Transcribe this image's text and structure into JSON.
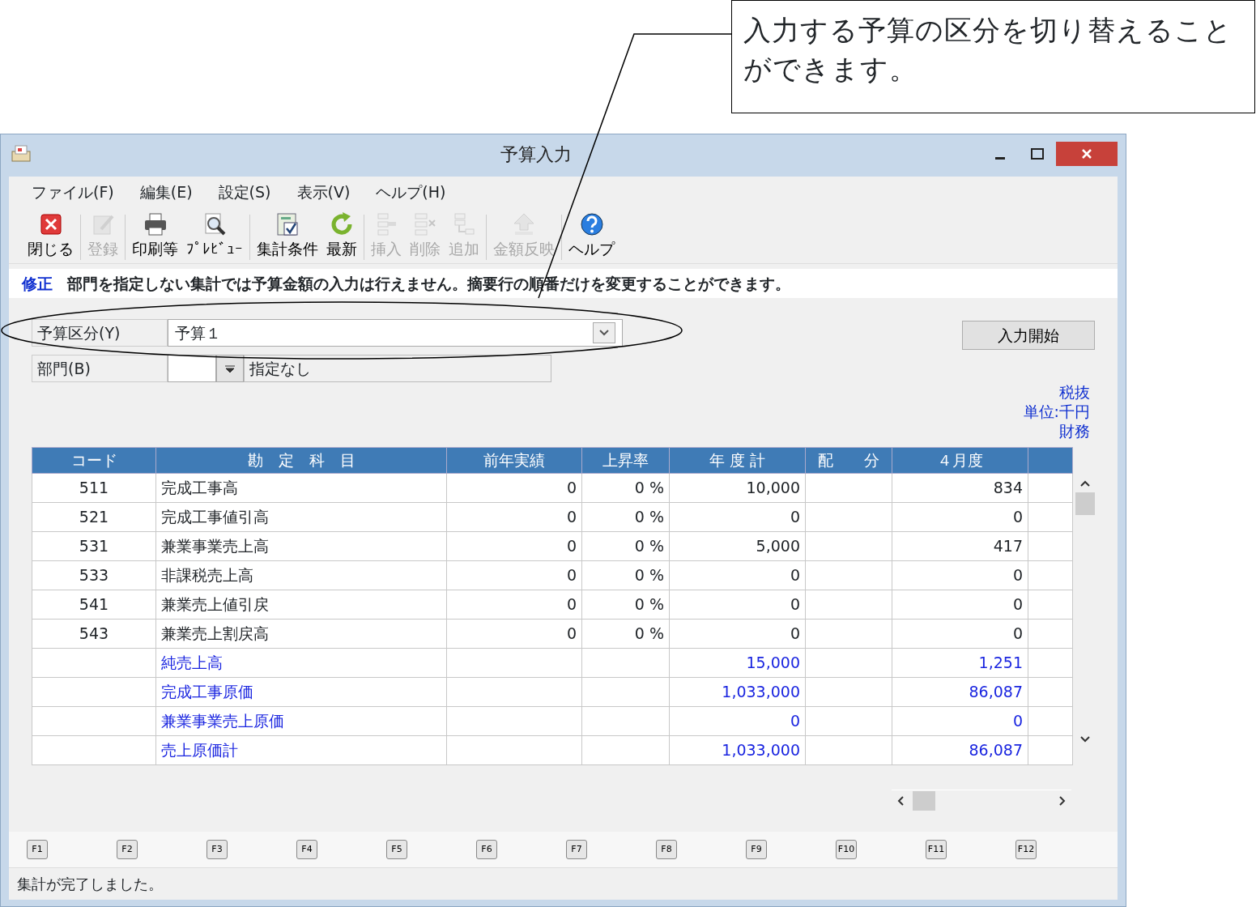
{
  "callout": {
    "text": "入力する予算の区分を切り替えることができます。"
  },
  "window": {
    "title": "予算入力"
  },
  "menu": [
    "ファイル(F)",
    "編集(E)",
    "設定(S)",
    "表示(V)",
    "ヘルプ(H)"
  ],
  "toolbar": [
    {
      "kind": "close",
      "label": "閉じる",
      "disabled": false
    },
    {
      "kind": "register",
      "label": "登録",
      "disabled": true
    },
    {
      "kind": "print",
      "label": "印刷等",
      "disabled": false
    },
    {
      "kind": "preview",
      "label": "ﾌﾟﾚﾋﾞｭｰ",
      "disabled": false
    },
    {
      "kind": "conditions",
      "label": "集計条件",
      "disabled": false
    },
    {
      "kind": "refresh",
      "label": "最新",
      "disabled": false
    },
    {
      "kind": "insert",
      "label": "挿入",
      "disabled": true
    },
    {
      "kind": "delete",
      "label": "削除",
      "disabled": true
    },
    {
      "kind": "append",
      "label": "追加",
      "disabled": true
    },
    {
      "kind": "reflect",
      "label": "金額反映",
      "disabled": true
    },
    {
      "kind": "help",
      "label": "ヘルプ",
      "disabled": false
    }
  ],
  "mode": {
    "label": "修正",
    "message": "部門を指定しない集計では予算金額の入力は行えません。摘要行の順番だけを変更することができます。"
  },
  "budget_type": {
    "label": "予算区分(Y)",
    "value": "予算１"
  },
  "department": {
    "label": "部門(B)",
    "name": "指定なし"
  },
  "start_button": "入力開始",
  "info": [
    "税抜",
    "単位:千円",
    "財務"
  ],
  "table": {
    "columns": [
      "コード",
      "勘　定　科　目",
      "前年実績",
      "上昇率",
      "年 度 計",
      "配　　分",
      "４月度"
    ],
    "rows": [
      {
        "kind": "account",
        "cells": [
          "511",
          "完成工事高",
          "0",
          "0 %",
          "10,000",
          "",
          "834"
        ]
      },
      {
        "kind": "account",
        "cells": [
          "521",
          "完成工事値引高",
          "0",
          "0 %",
          "0",
          "",
          "0"
        ]
      },
      {
        "kind": "account",
        "cells": [
          "531",
          "兼業事業売上高",
          "0",
          "0 %",
          "5,000",
          "",
          "417"
        ]
      },
      {
        "kind": "account",
        "cells": [
          "533",
          "非課税売上高",
          "0",
          "0 %",
          "0",
          "",
          "0"
        ]
      },
      {
        "kind": "account",
        "cells": [
          "541",
          "兼業売上値引戻",
          "0",
          "0 %",
          "0",
          "",
          "0"
        ]
      },
      {
        "kind": "account",
        "cells": [
          "543",
          "兼業売上割戻高",
          "0",
          "0 %",
          "0",
          "",
          "0"
        ]
      },
      {
        "kind": "total",
        "cells": [
          "",
          "純売上高",
          "",
          "",
          "15,000",
          "",
          "1,251"
        ]
      },
      {
        "kind": "total",
        "cells": [
          "",
          "完成工事原価",
          "",
          "",
          "1,033,000",
          "",
          "86,087"
        ]
      },
      {
        "kind": "total",
        "cells": [
          "",
          "兼業事業売上原価",
          "",
          "",
          "0",
          "",
          "0"
        ]
      },
      {
        "kind": "total",
        "cells": [
          "",
          "売上原価計",
          "",
          "",
          "1,033,000",
          "",
          "86,087"
        ]
      }
    ]
  },
  "function_keys": [
    "F1",
    "F2",
    "F3",
    "F4",
    "F5",
    "F6",
    "F7",
    "F8",
    "F9",
    "F10",
    "F11",
    "F12"
  ],
  "status_bar": "集計が完了しました。"
}
